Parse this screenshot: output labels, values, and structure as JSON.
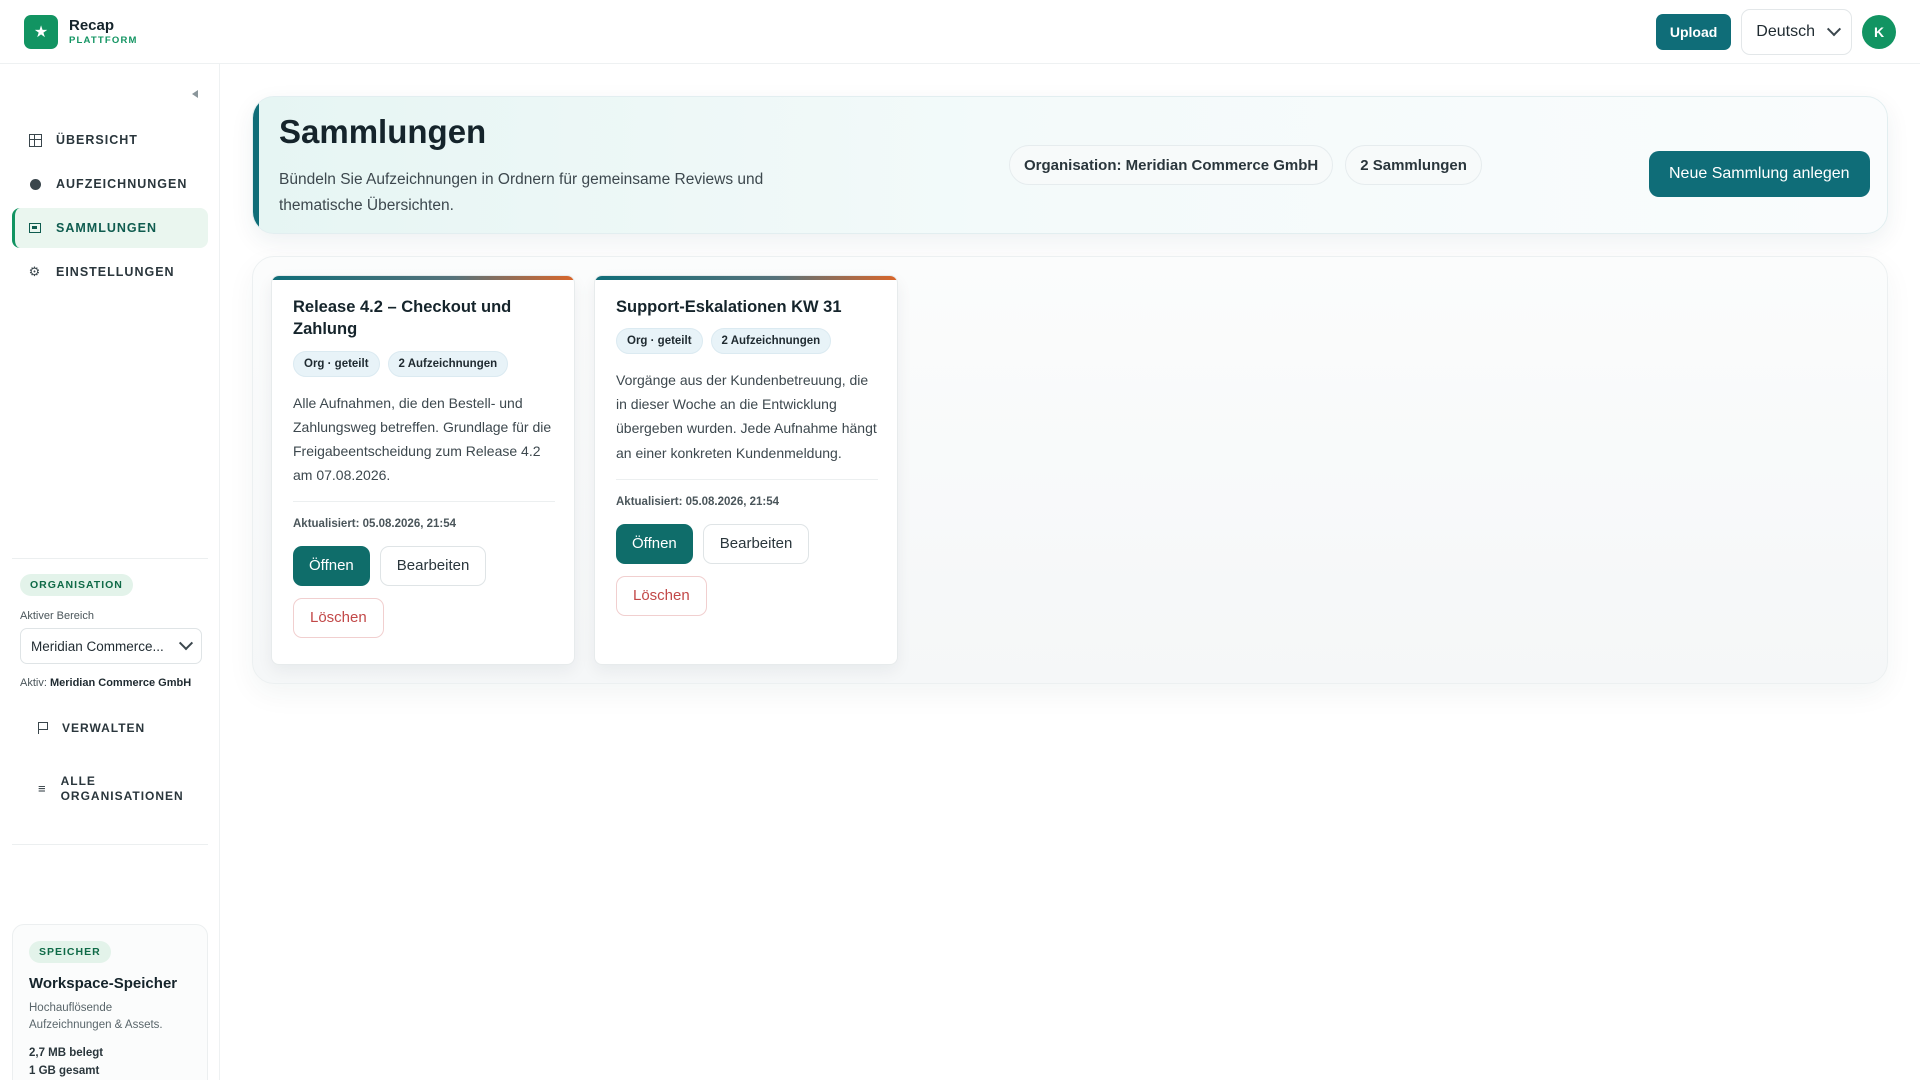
{
  "brand": {
    "logo_glyph": "★",
    "name": "Recap",
    "sub": "PLATTFORM"
  },
  "header": {
    "upload_label": "Upload",
    "language": "Deutsch",
    "avatar_initial": "K"
  },
  "sidebar": {
    "items": [
      {
        "label": "ÜBERSICHT",
        "icon": "grid-icon",
        "active": false
      },
      {
        "label": "AUFZEICHNUNGEN",
        "icon": "record-icon",
        "active": false
      },
      {
        "label": "SAMMLUNGEN",
        "icon": "folder-icon",
        "active": true
      },
      {
        "label": "EINSTELLUNGEN",
        "icon": "gear-icon",
        "active": false
      }
    ],
    "organisation": {
      "badge": "ORGANISATION",
      "area_label": "Aktiver Bereich",
      "area_value": "Meridian Commerce...",
      "active_prefix": "Aktiv:",
      "active_name": "Meridian Commerce GmbH",
      "manage_label": "VERWALTEN",
      "all_orgs_label": "ALLE ORGANISATIONEN"
    },
    "storage": {
      "badge": "SPEICHER",
      "title": "Workspace-Speicher",
      "description": "Hochauflösende Aufzeichnungen & Assets.",
      "used": "2,7 MB belegt",
      "total": "1 GB gesamt",
      "used_fraction": 0.003
    }
  },
  "hero": {
    "title": "Sammlungen",
    "description": "Bündeln Sie Aufzeichnungen in Ordnern für gemeinsame Reviews und thematische Übersichten.",
    "org_badge": "Organisation: Meridian Commerce GmbH",
    "count_badge": "2 Sammlungen",
    "new_button": "Neue Sammlung anlegen"
  },
  "collections": [
    {
      "title": "Release 4.2 – Checkout und Zahlung",
      "tags": [
        "Org · geteilt",
        "2 Aufzeichnungen"
      ],
      "description": "Alle Aufnahmen, die den Bestell- und Zahlungsweg betreffen. Grundlage für die Freigabeentscheidung zum Release 4.2 am 07.08.2026.",
      "updated": "Aktualisiert: 05.08.2026, 21:54",
      "open_label": "Öffnen",
      "edit_label": "Bearbeiten",
      "delete_label": "Löschen"
    },
    {
      "title": "Support-Eskalationen KW 31",
      "tags": [
        "Org · geteilt",
        "2 Aufzeichnungen"
      ],
      "description": "Vorgänge aus der Kundenbetreuung, die in dieser Woche an die Entwicklung übergeben wurden. Jede Aufnahme hängt an einer konkreten Kundenmeldung.",
      "updated": "Aktualisiert: 05.08.2026, 21:54",
      "open_label": "Öffnen",
      "edit_label": "Bearbeiten",
      "delete_label": "Löschen"
    }
  ],
  "colors": {
    "brand_green": "#129462",
    "primary_teal": "#0f6d78",
    "danger": "#c24848"
  }
}
